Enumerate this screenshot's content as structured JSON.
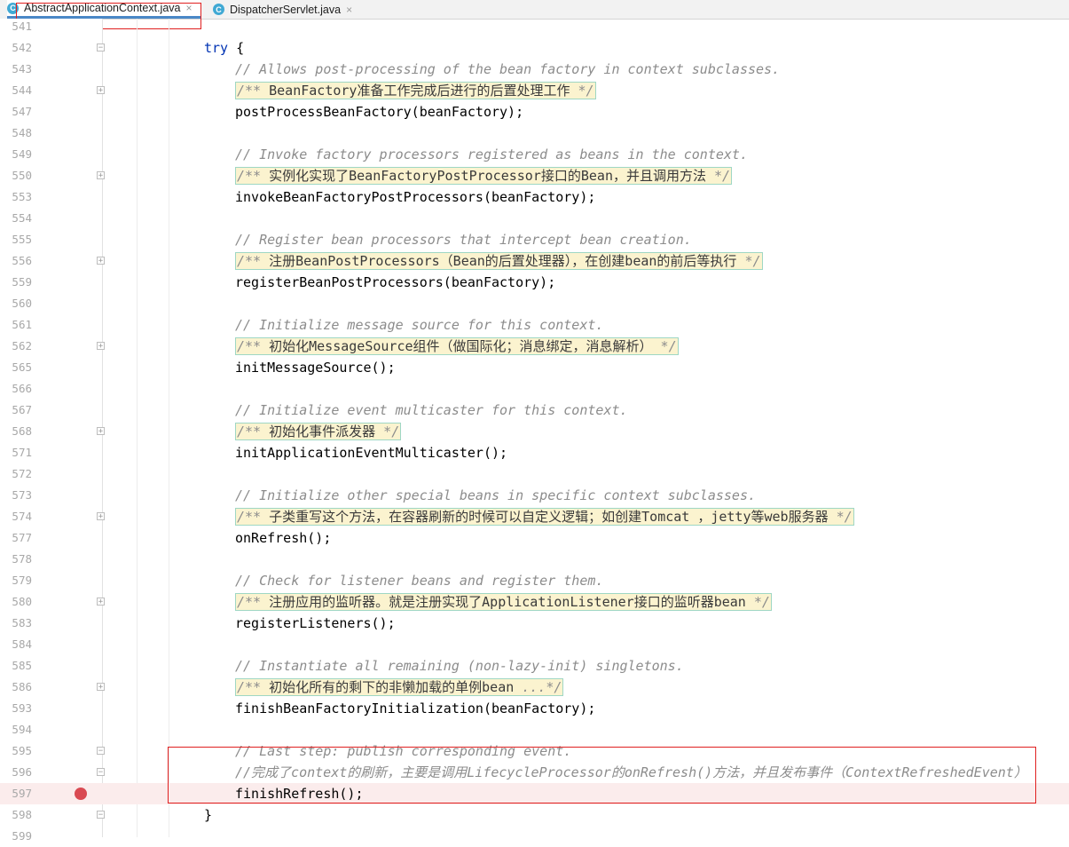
{
  "tabs": [
    {
      "label": "AbstractApplicationContext.java",
      "icon": "class-icon",
      "active": true
    },
    {
      "label": "DispatcherServlet.java",
      "icon": "class-icon",
      "active": false
    }
  ],
  "tab_icon_letter": "C",
  "close_glyph": "×",
  "lines": [
    {
      "n": "541",
      "indent": 0,
      "type": "plain",
      "text": ""
    },
    {
      "n": "542",
      "indent": 0,
      "type": "try",
      "keyword": "try",
      "text": " {",
      "fold": "open"
    },
    {
      "n": "543",
      "indent": 1,
      "type": "comment",
      "text": "// Allows post-processing of the bean factory in context subclasses."
    },
    {
      "n": "544",
      "indent": 1,
      "type": "doc",
      "prefix": "/** ",
      "text": "BeanFactory准备工作完成后进行的后置处理工作",
      "suffix": " */",
      "fold": "closed"
    },
    {
      "n": "547",
      "indent": 1,
      "type": "plain",
      "text": "postProcessBeanFactory(beanFactory);"
    },
    {
      "n": "548",
      "indent": 1,
      "type": "plain",
      "text": ""
    },
    {
      "n": "549",
      "indent": 1,
      "type": "comment",
      "text": "// Invoke factory processors registered as beans in the context."
    },
    {
      "n": "550",
      "indent": 1,
      "type": "doc",
      "prefix": "/** ",
      "text": "实例化实现了BeanFactoryPostProcessor接口的Bean，并且调用方法",
      "suffix": " */",
      "fold": "closed"
    },
    {
      "n": "553",
      "indent": 1,
      "type": "plain",
      "text": "invokeBeanFactoryPostProcessors(beanFactory);"
    },
    {
      "n": "554",
      "indent": 1,
      "type": "plain",
      "text": ""
    },
    {
      "n": "555",
      "indent": 1,
      "type": "comment",
      "text": "// Register bean processors that intercept bean creation."
    },
    {
      "n": "556",
      "indent": 1,
      "type": "doc",
      "prefix": "/** ",
      "text": "注册BeanPostProcessors（Bean的后置处理器），在创建bean的前后等执行",
      "suffix": " */",
      "fold": "closed"
    },
    {
      "n": "559",
      "indent": 1,
      "type": "plain",
      "text": "registerBeanPostProcessors(beanFactory);"
    },
    {
      "n": "560",
      "indent": 1,
      "type": "plain",
      "text": ""
    },
    {
      "n": "561",
      "indent": 1,
      "type": "comment",
      "text": "// Initialize message source for this context."
    },
    {
      "n": "562",
      "indent": 1,
      "type": "doc",
      "prefix": "/** ",
      "text": "初始化MessageSource组件（做国际化；消息绑定，消息解析）",
      "suffix": " */",
      "fold": "closed"
    },
    {
      "n": "565",
      "indent": 1,
      "type": "plain",
      "text": "initMessageSource();"
    },
    {
      "n": "566",
      "indent": 1,
      "type": "plain",
      "text": ""
    },
    {
      "n": "567",
      "indent": 1,
      "type": "comment",
      "text": "// Initialize event multicaster for this context."
    },
    {
      "n": "568",
      "indent": 1,
      "type": "doc",
      "prefix": "/** ",
      "text": "初始化事件派发器",
      "suffix": " */",
      "fold": "closed"
    },
    {
      "n": "571",
      "indent": 1,
      "type": "plain",
      "text": "initApplicationEventMulticaster();"
    },
    {
      "n": "572",
      "indent": 1,
      "type": "plain",
      "text": ""
    },
    {
      "n": "573",
      "indent": 1,
      "type": "comment",
      "text": "// Initialize other special beans in specific context subclasses."
    },
    {
      "n": "574",
      "indent": 1,
      "type": "doc",
      "prefix": "/** ",
      "text": "子类重写这个方法，在容器刷新的时候可以自定义逻辑；如创建Tomcat ，jetty等web服务器",
      "suffix": " */",
      "fold": "closed"
    },
    {
      "n": "577",
      "indent": 1,
      "type": "plain",
      "text": "onRefresh();"
    },
    {
      "n": "578",
      "indent": 1,
      "type": "plain",
      "text": ""
    },
    {
      "n": "579",
      "indent": 1,
      "type": "comment",
      "text": "// Check for listener beans and register them."
    },
    {
      "n": "580",
      "indent": 1,
      "type": "doc",
      "prefix": "/** ",
      "text": "注册应用的监听器。就是注册实现了ApplicationListener接口的监听器bean",
      "suffix": " */",
      "fold": "closed"
    },
    {
      "n": "583",
      "indent": 1,
      "type": "plain",
      "text": "registerListeners();"
    },
    {
      "n": "584",
      "indent": 1,
      "type": "plain",
      "text": ""
    },
    {
      "n": "585",
      "indent": 1,
      "type": "comment",
      "text": "// Instantiate all remaining (non-lazy-init) singletons."
    },
    {
      "n": "586",
      "indent": 1,
      "type": "doc",
      "prefix": "/** ",
      "text": "初始化所有的剩下的非懒加载的单例bean",
      "suffix": " ...*/",
      "fold": "closed"
    },
    {
      "n": "593",
      "indent": 1,
      "type": "plain",
      "text": "finishBeanFactoryInitialization(beanFactory);"
    },
    {
      "n": "594",
      "indent": 1,
      "type": "plain",
      "text": ""
    },
    {
      "n": "595",
      "indent": 1,
      "type": "comment",
      "text": "// Last step: publish corresponding event.",
      "fold": "open"
    },
    {
      "n": "596",
      "indent": 1,
      "type": "comment",
      "text": "//完成了context的刷新，主要是调用LifecycleProcessor的onRefresh()方法，并且发布事件（ContextRefreshedEvent）",
      "fold": "end"
    },
    {
      "n": "597",
      "indent": 1,
      "type": "plain",
      "text": "finishRefresh();",
      "breakpoint": true
    },
    {
      "n": "598",
      "indent": 0,
      "type": "plain",
      "text": "}",
      "fold": "end"
    },
    {
      "n": "599",
      "indent": 0,
      "type": "plain",
      "text": ""
    }
  ],
  "colors": {
    "keyword": "#0033b3",
    "comment": "#8c8c8c",
    "doc_background": "#fbf3cf",
    "doc_border": "#9fd7c4",
    "breakpoint": "#d94a52",
    "annotation_box": "#e02020"
  }
}
